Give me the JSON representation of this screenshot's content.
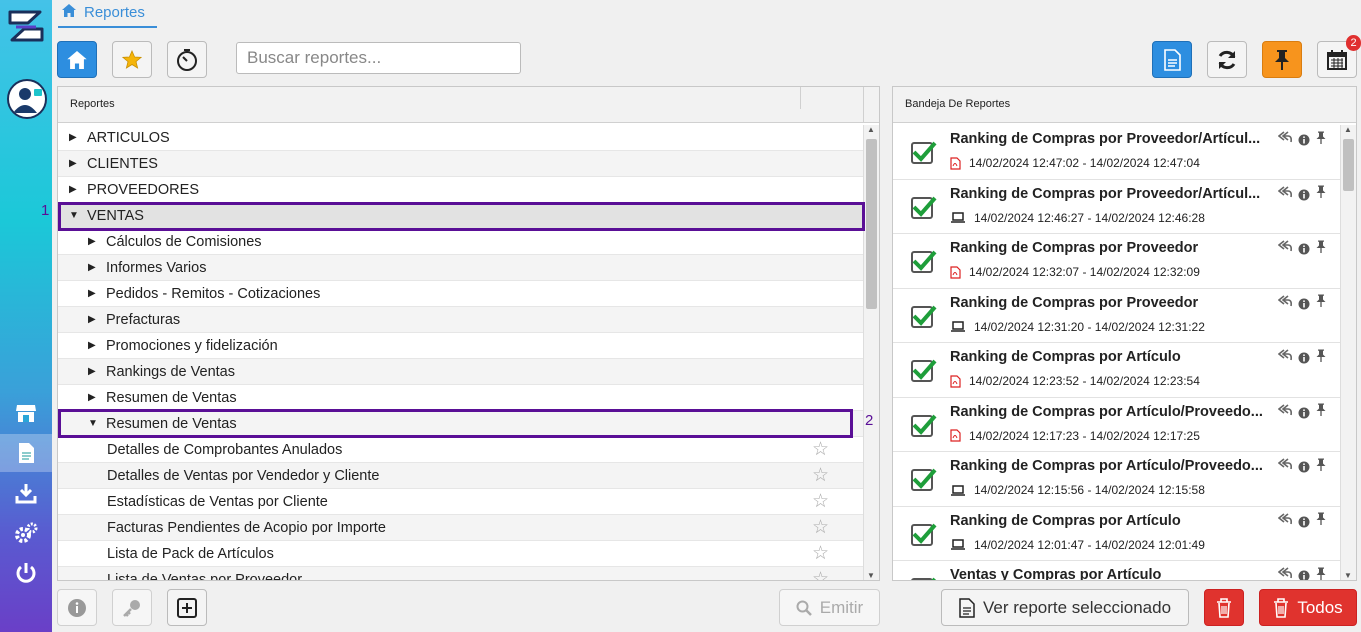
{
  "breadcrumb": {
    "label": "Reportes"
  },
  "search": {
    "placeholder": "Buscar reportes..."
  },
  "toolbar": {
    "badge_count": "2"
  },
  "tree": {
    "header": "Reportes",
    "rows": [
      {
        "label": "ARTICULOS",
        "level": 0,
        "expanded": false
      },
      {
        "label": "CLIENTES",
        "level": 0,
        "expanded": false
      },
      {
        "label": "PROVEEDORES",
        "level": 0,
        "expanded": false
      },
      {
        "label": "VENTAS",
        "level": 0,
        "expanded": true
      },
      {
        "label": "Cálculos de Comisiones",
        "level": 1,
        "expanded": false
      },
      {
        "label": "Informes Varios",
        "level": 1,
        "expanded": false
      },
      {
        "label": "Pedidos - Remitos - Cotizaciones",
        "level": 1,
        "expanded": false
      },
      {
        "label": "Prefacturas",
        "level": 1,
        "expanded": false
      },
      {
        "label": "Promociones y fidelización",
        "level": 1,
        "expanded": false
      },
      {
        "label": "Rankings de Ventas",
        "level": 1,
        "expanded": false
      },
      {
        "label": "Resumen de Ventas",
        "level": 1,
        "expanded": false
      },
      {
        "label": "Resumen de Ventas",
        "level": 1,
        "expanded": true
      },
      {
        "label": "Detalles de Comprobantes Anulados",
        "level": 2,
        "leaf": true
      },
      {
        "label": "Detalles de Ventas por Vendedor y Cliente",
        "level": 2,
        "leaf": true
      },
      {
        "label": "Estadísticas de Ventas por Cliente",
        "level": 2,
        "leaf": true
      },
      {
        "label": "Facturas Pendientes de Acopio por Importe",
        "level": 2,
        "leaf": true
      },
      {
        "label": "Lista de Pack de Artículos",
        "level": 2,
        "leaf": true
      },
      {
        "label": "Lista de Ventas por Proveedor",
        "level": 2,
        "leaf": true
      }
    ]
  },
  "annotations": {
    "first": "1",
    "second": "2"
  },
  "tray": {
    "header": "Bandeja De Reportes",
    "items": [
      {
        "title": "Ranking de Compras por Proveedor/Artícul...",
        "format": "pdf",
        "date": "14/02/2024 12:47:02 - 14/02/2024 12:47:04"
      },
      {
        "title": "Ranking de Compras por Proveedor/Artícul...",
        "format": "screen",
        "date": "14/02/2024 12:46:27 - 14/02/2024 12:46:28"
      },
      {
        "title": "Ranking de Compras por Proveedor",
        "format": "pdf",
        "date": "14/02/2024 12:32:07 - 14/02/2024 12:32:09"
      },
      {
        "title": "Ranking de Compras por Proveedor",
        "format": "screen",
        "date": "14/02/2024 12:31:20 - 14/02/2024 12:31:22"
      },
      {
        "title": "Ranking de Compras por Artículo",
        "format": "pdf",
        "date": "14/02/2024 12:23:52 - 14/02/2024 12:23:54"
      },
      {
        "title": "Ranking de Compras por Artículo/Proveedo...",
        "format": "pdf",
        "date": "14/02/2024 12:17:23 - 14/02/2024 12:17:25"
      },
      {
        "title": "Ranking de Compras por Artículo/Proveedo...",
        "format": "screen",
        "date": "14/02/2024 12:15:56 - 14/02/2024 12:15:58"
      },
      {
        "title": "Ranking de Compras por Artículo",
        "format": "screen",
        "date": "14/02/2024 12:01:47 - 14/02/2024 12:01:49"
      },
      {
        "title": "Ventas y Compras por Artículo",
        "format": "screen",
        "date": ""
      }
    ]
  },
  "footer": {
    "emit_label": "Emitir",
    "view_selected_label": "Ver reporte seleccionado",
    "delete_all_label": "Todos"
  },
  "colors": {
    "accent": "#2d8ee0",
    "pin": "#f7941d",
    "danger": "#e0332e",
    "highlight": "#5a0f96",
    "check": "#1e9e3a"
  }
}
